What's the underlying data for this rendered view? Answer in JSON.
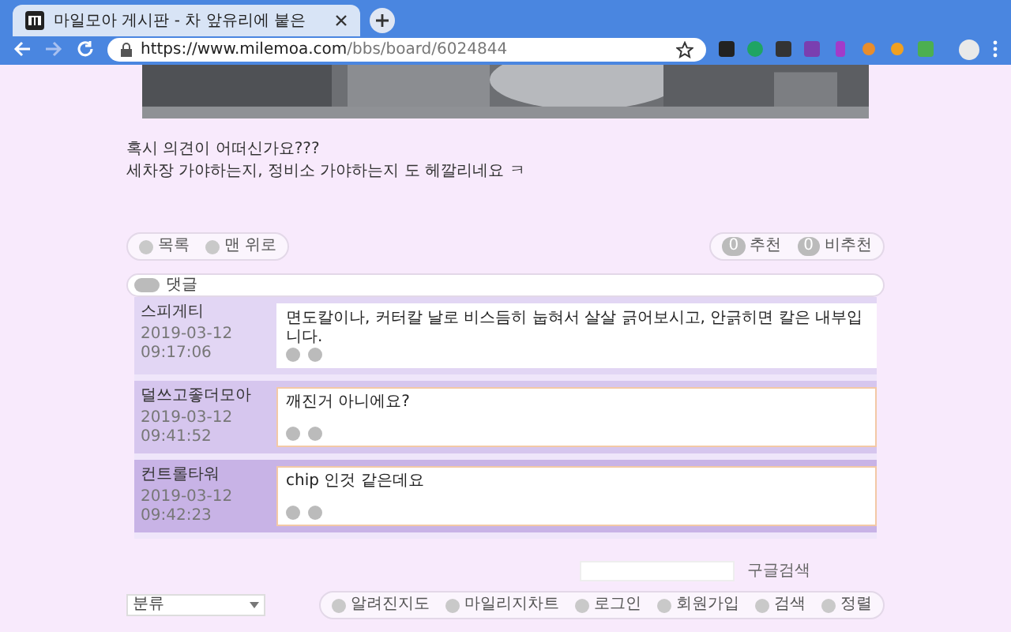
{
  "browser": {
    "tab_title": "마일모아 게시판 - 차 앞유리에 붙은",
    "url_host": "https://www.milemoa.com",
    "url_path": "/bbs/board/6024844"
  },
  "post": {
    "lines": [
      "혹시 의견이 어떠신가요???",
      "세차장 가야하는지, 정비소 가야하는지 도 헤깔리네요 ㅋ"
    ]
  },
  "nav_buttons": [
    "목록",
    "맨 위로"
  ],
  "votes": [
    {
      "count": "0",
      "label": "추천"
    },
    {
      "count": "0",
      "label": "비추천"
    }
  ],
  "comments_header": "댓글",
  "comments": [
    {
      "author": "스피게티",
      "date": "2019-03-12",
      "time": "09:17:06",
      "text": "면도칼이나, 커터칼 날로 비스듬히 눕혀서 살살 긁어보시고, 안긁히면 칼은 내부입니다.",
      "highlighted": false
    },
    {
      "author": "덜쓰고좋더모아",
      "date": "2019-03-12",
      "time": "09:41:52",
      "text": "깨진거 아니에요?",
      "highlighted": true
    },
    {
      "author": "컨트롤타워",
      "date": "2019-03-12",
      "time": "09:42:23",
      "text": "chip 인것 같은데요",
      "highlighted": true
    }
  ],
  "search_button": "구글검색",
  "category_select": "분류",
  "footer_links": [
    "알려진지도",
    "마일리지차트",
    "로그인",
    "회원가입",
    "검색",
    "정렬"
  ]
}
